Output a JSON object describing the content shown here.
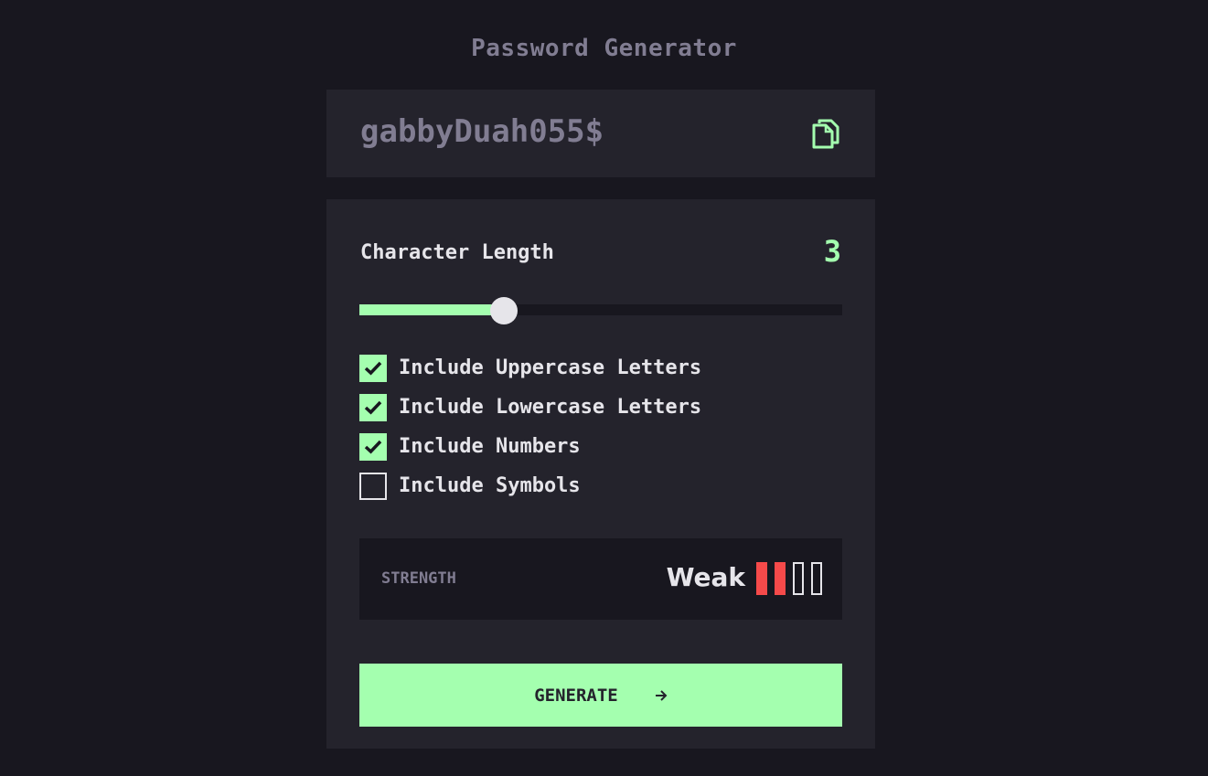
{
  "app": {
    "title": "Password Generator"
  },
  "output": {
    "password": "gabbyDuah055$",
    "copy_icon": "copy-icon"
  },
  "length": {
    "label": "Character Length",
    "value": "3",
    "fraction": 0.3
  },
  "options": [
    {
      "label": "Include Uppercase Letters",
      "checked": true
    },
    {
      "label": "Include Lowercase Letters",
      "checked": true
    },
    {
      "label": "Include Numbers",
      "checked": true
    },
    {
      "label": "Include Symbols",
      "checked": false
    }
  ],
  "strength": {
    "label": "STRENGTH",
    "value": "Weak",
    "level": 2,
    "max": 4,
    "color": "#f64a4a"
  },
  "generate": {
    "label": "GENERATE",
    "icon": "arrow-right-icon"
  },
  "colors": {
    "accent": "#a4ffaf",
    "background": "#18171f",
    "panel": "#24232c",
    "muted": "#817d92"
  }
}
